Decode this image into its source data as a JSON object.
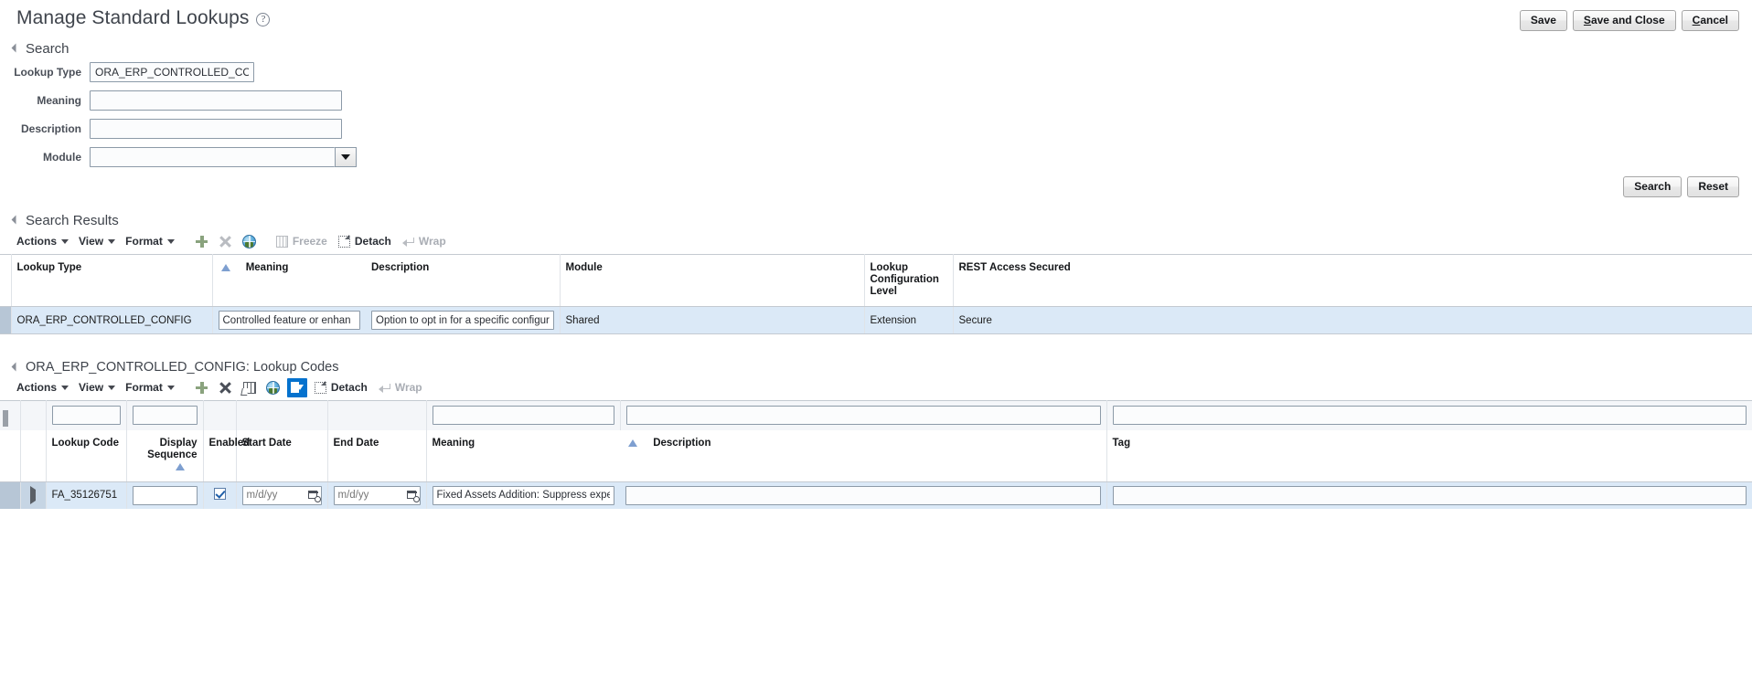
{
  "header": {
    "title": "Manage Standard Lookups",
    "help_icon": "help-icon",
    "buttons": {
      "save": "Save",
      "save_and_close_pre": "S",
      "save_and_close_post": "ave and Close",
      "cancel_pre": "C",
      "cancel_post": "ancel"
    }
  },
  "search": {
    "section_title": "Search",
    "fields": [
      {
        "label": "Lookup Type",
        "value": "ORA_ERP_CONTROLLED_CONFIG",
        "placeholder": ""
      },
      {
        "label": "Meaning",
        "value": "",
        "placeholder": ""
      },
      {
        "label": "Description",
        "value": "",
        "placeholder": ""
      },
      {
        "label": "Module",
        "value": "",
        "placeholder": ""
      }
    ],
    "search_button": "Search",
    "reset_button": "Reset"
  },
  "results": {
    "section_title": "Search Results",
    "toolbar": {
      "actions": "Actions",
      "view": "View",
      "format": "Format",
      "add_icon": "plus-icon",
      "delete_icon": "delete-x-icon",
      "translation_icon": "globe-icon",
      "freeze": "Freeze",
      "detach": "Detach",
      "wrap": "Wrap"
    },
    "columns": [
      "Lookup Type",
      "Meaning",
      "Description",
      "Module",
      "Lookup Configuration Level",
      "REST Access Secured"
    ],
    "rows": [
      {
        "lookup_type": "ORA_ERP_CONTROLLED_CONFIG",
        "meaning": "Controlled feature or enhan",
        "description": "Option to opt in for a specific configuration in",
        "module": "Shared",
        "config_level": "Extension",
        "rest_access": "Secure",
        "selected": true
      }
    ]
  },
  "codes": {
    "section_title": "ORA_ERP_CONTROLLED_CONFIG: Lookup Codes",
    "toolbar": {
      "actions": "Actions",
      "view": "View",
      "format": "Format",
      "add_icon": "plus-icon",
      "delete_icon": "delete-x-icon",
      "sort_icon": "sort-detail-icon",
      "translation_icon": "globe-icon",
      "query_icon": "query-by-example-icon",
      "detach": "Detach",
      "wrap": "Wrap"
    },
    "columns": [
      "Lookup Code",
      "Display Sequence",
      "Enabled",
      "Start Date",
      "End Date",
      "Meaning",
      "Description",
      "Tag"
    ],
    "filters": {
      "lookup_code": "",
      "display_sequence": "",
      "meaning": "",
      "description": "",
      "tag": ""
    },
    "rows": [
      {
        "lookup_code": "FA_35126751",
        "display_sequence": "",
        "enabled": true,
        "start_date": "",
        "start_date_placeholder": "m/d/yy",
        "end_date": "",
        "end_date_placeholder": "m/d/yy",
        "meaning": "Fixed Assets Addition: Suppress expense ac",
        "description": "",
        "tag": "",
        "selected": true
      }
    ]
  },
  "colors": {
    "accent": "#0572ce",
    "selected_row": "#dbe9f7",
    "title_text": "#3f444c",
    "border": "#8c9aa8"
  }
}
